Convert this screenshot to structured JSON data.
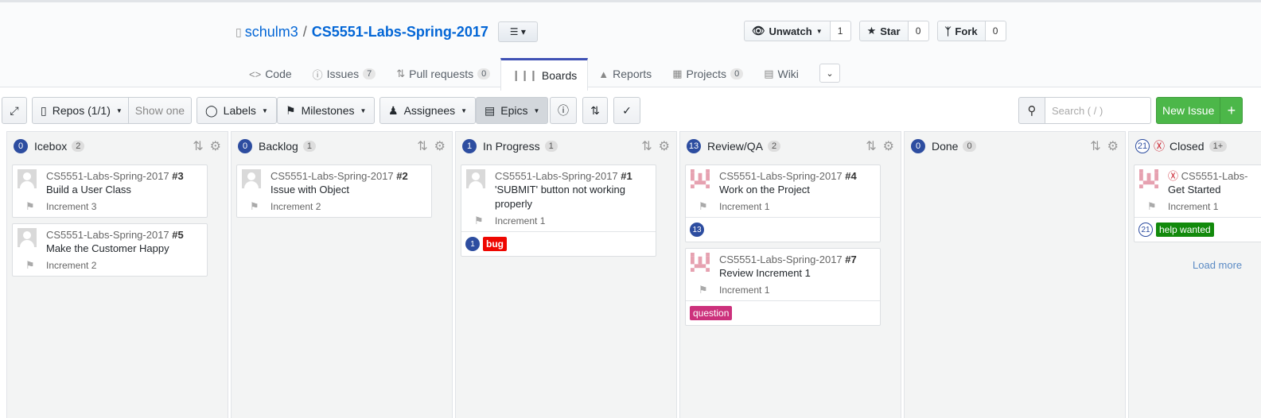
{
  "repo": {
    "owner": "schulm3",
    "separator": "/",
    "name": "CS5551-Labs-Spring-2017"
  },
  "actions": [
    {
      "label": "Unwatch",
      "count": "1",
      "icon": "eye-icon"
    },
    {
      "label": "Star",
      "count": "0",
      "icon": "star-icon"
    },
    {
      "label": "Fork",
      "count": "0",
      "icon": "fork-icon"
    }
  ],
  "tabs": [
    {
      "label": "Code",
      "count": ""
    },
    {
      "label": "Issues",
      "count": "7"
    },
    {
      "label": "Pull requests",
      "count": "0"
    },
    {
      "label": "Boards",
      "count": ""
    },
    {
      "label": "Reports",
      "count": ""
    },
    {
      "label": "Projects",
      "count": "0"
    },
    {
      "label": "Wiki",
      "count": ""
    }
  ],
  "toolbar": {
    "repos": "Repos (1/1)",
    "show_one": "Show one",
    "labels": "Labels",
    "milestones": "Milestones",
    "assignees": "Assignees",
    "epics": "Epics",
    "search_placeholder": "Search ( / )",
    "new_issue": "New Issue",
    "plus": "+"
  },
  "columns": [
    {
      "name": "Icebox",
      "estimate": "0",
      "issues": "2",
      "cards": [
        {
          "repo": "CS5551-Labs-Spring-2017",
          "num": "#3",
          "title": "Build a User Class",
          "milestone": "Increment 3"
        },
        {
          "repo": "CS5551-Labs-Spring-2017",
          "num": "#5",
          "title": "Make the Customer Happy",
          "milestone": "Increment 2"
        }
      ]
    },
    {
      "name": "Backlog",
      "estimate": "0",
      "issues": "1",
      "cards": [
        {
          "repo": "CS5551-Labs-Spring-2017",
          "num": "#2",
          "title": "Issue with Object",
          "milestone": "Increment 2"
        }
      ]
    },
    {
      "name": "In Progress",
      "estimate": "1",
      "issues": "1",
      "cards": [
        {
          "repo": "CS5551-Labs-Spring-2017",
          "num": "#1",
          "title": "'SUBMIT' button not working properly",
          "milestone": "Increment 1",
          "estimate": "1",
          "label": "bug"
        }
      ]
    },
    {
      "name": "Review/QA",
      "estimate": "13",
      "issues": "2",
      "cards": [
        {
          "repo": "CS5551-Labs-Spring-2017",
          "num": "#4",
          "title": "Work on the Project",
          "milestone": "Increment 1",
          "estimate": "13"
        },
        {
          "repo": "CS5551-Labs-Spring-2017",
          "num": "#7",
          "title": "Review Increment 1",
          "milestone": "Increment 1",
          "label": "question"
        }
      ]
    },
    {
      "name": "Done",
      "estimate": "0",
      "issues": "0",
      "cards": []
    },
    {
      "name": "Closed",
      "estimate": "21",
      "issues": "1+",
      "cards": [
        {
          "repo": "CS5551-Labs-",
          "num": "",
          "title": "Get Started",
          "milestone": "Increment 1",
          "estimate": "21",
          "label": "help wanted"
        }
      ],
      "load_more": "Load more"
    }
  ],
  "colors": {
    "accent": "#3f51b5",
    "estimate_badge": "#2d4da0",
    "bug": "#ee0701",
    "question": "#cc317c",
    "help_wanted": "#128a0c",
    "new_issue": "#4cb749"
  }
}
